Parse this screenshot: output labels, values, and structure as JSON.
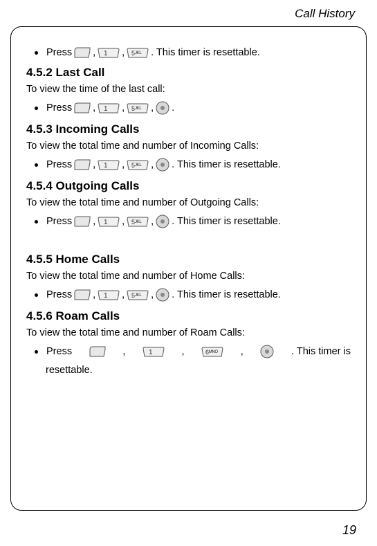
{
  "header": "Call History",
  "page_number": "19",
  "sections": [
    {
      "bullets": [
        {
          "press": "Press ",
          "afterKeys": ". This timer is resettable."
        }
      ]
    },
    {
      "heading": "4.5.2 Last Call",
      "text": "To view the time of the last call:",
      "bullets": [
        {
          "press": "Press ",
          "afterKeys": "."
        }
      ]
    },
    {
      "heading": "4.5.3 Incoming Calls",
      "text": "To view the total time and number of Incoming Calls:",
      "bullets": [
        {
          "press": "Press ",
          "afterKeys": ". This timer is resettable."
        }
      ]
    },
    {
      "heading": "4.5.4 Outgoing Calls",
      "text": "To view the total time and number of Outgoing Calls:",
      "bullets": [
        {
          "press": "Press ",
          "afterKeys": ". This timer is resettable."
        }
      ]
    },
    {
      "heading": "4.5.5 Home Calls",
      "text": "To view the total time and number of Home Calls:",
      "bullets": [
        {
          "press": "Press ",
          "afterKeys": ". This timer is resettable."
        }
      ]
    },
    {
      "heading": "4.5.6 Roam Calls",
      "text": "To view the total time and number of Roam Calls:",
      "bullets": [
        {
          "press": "Press ",
          "afterKeys": ". This timer is",
          "wrap": "resettable."
        }
      ]
    }
  ],
  "key_labels": {
    "one": "1",
    "five": "5",
    "six": "6"
  }
}
